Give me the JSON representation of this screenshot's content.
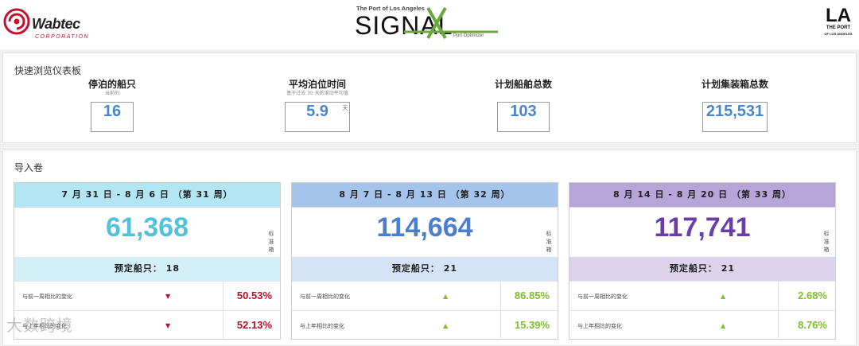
{
  "header": {
    "wabtec_name": "Wabtec",
    "wabtec_sub": "CORPORATION",
    "signal_top": "The Port of Los Angeles",
    "signal_word": "SIGNAL",
    "signal_by": "Port Optimizer",
    "la_mark": "LA",
    "la_text_1": "THE PORT",
    "la_text_2": "OF LOS ANGELES"
  },
  "dashboard": {
    "title": "快速浏览仪表板",
    "kpis": [
      {
        "label": "停泊的船只",
        "sub": "当前的",
        "value": "16",
        "unit": ""
      },
      {
        "label": "平均泊位时间",
        "sub": "基于过去 30 天的滚动平均值",
        "value": "5.9",
        "unit": "天"
      },
      {
        "label": "计划船舶总数",
        "sub": "",
        "value": "103",
        "unit": ""
      },
      {
        "label": "计划集装箱总数",
        "sub": "",
        "value": "215,531",
        "unit": ""
      }
    ]
  },
  "volume": {
    "title": "导入卷",
    "unit_label": "标准箱",
    "weeks": [
      {
        "header": "7 月 31 日 - 8 月 6 日 （第 31 周）",
        "value": "61,368",
        "ships": "预定船只： 18",
        "head_color": "#b2e6f2",
        "ships_color": "#d3eff7",
        "value_color": "#52c2dc",
        "changes": [
          {
            "label": "与前一周相比的变化",
            "value": "50.53%",
            "dir": "down"
          },
          {
            "label": "与上年相比的变化",
            "value": "52.13%",
            "dir": "down"
          }
        ]
      },
      {
        "header": "8 月 7 日 - 8 月 13 日 （第 32 周）",
        "value": "114,664",
        "ships": "预定船只： 21",
        "head_color": "#a5c4ec",
        "ships_color": "#d4e3f7",
        "value_color": "#4a7fd0",
        "changes": [
          {
            "label": "与前一周相比的变化",
            "value": "86.85%",
            "dir": "up"
          },
          {
            "label": "与上年相比的变化",
            "value": "15.39%",
            "dir": "up"
          }
        ]
      },
      {
        "header": "8 月 14 日 - 8 月 20 日 （第 33 周）",
        "value": "117,741",
        "ships": "预定船只： 21",
        "head_color": "#b7a5d8",
        "ships_color": "#ddd3ec",
        "value_color": "#6a3ea8",
        "changes": [
          {
            "label": "与前一周相比的变化",
            "value": "2.68%",
            "dir": "up"
          },
          {
            "label": "与上年相比的变化",
            "value": "8.76%",
            "dir": "up"
          }
        ]
      }
    ]
  },
  "colors": {
    "up": "#7cc02c",
    "down": "#b5122b"
  },
  "watermark": "大数跨境"
}
